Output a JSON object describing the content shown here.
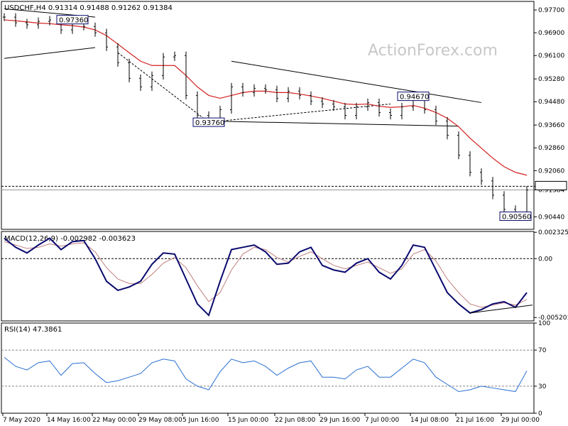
{
  "watermark": "ActionForex.com",
  "colors": {
    "price": "#000000",
    "ma": "#d22020",
    "macd": "#0a0a6e",
    "signal": "#c08080",
    "rsi": "#2a6fd0",
    "trend": "#000000",
    "tagBorder": "#0a0a6e"
  },
  "chart_data": [
    {
      "type": "line",
      "title": "USDCHF,H4  0.91314 0.91488 0.91262 0.91384",
      "ylim": [
        0.9,
        0.98
      ],
      "yticks": [
        "0.97700",
        "0.96900",
        "0.96100",
        "0.95280",
        "0.94480",
        "0.93660",
        "0.92860",
        "0.92060",
        "0.91510",
        "0.91384",
        "0.90440"
      ],
      "ytick_values": [
        0.977,
        0.969,
        0.961,
        0.9528,
        0.9448,
        0.9366,
        0.9286,
        0.9206,
        0.9151,
        0.91384,
        0.9044
      ],
      "x": [
        "7 May 2020",
        "14 May 16:00",
        "22 May 00:00",
        "29 May 08:00",
        "5 Jun 16:00",
        "15 Jun 00:00",
        "22 Jun 08:00",
        "29 Jun 16:00",
        "7 Jul 00:00",
        "14 Jul 08:00",
        "21 Jul 16:00",
        "29 Jul 00:00"
      ],
      "series": [
        {
          "values": [
            0.9745,
            0.9725,
            0.9718,
            0.973,
            0.9735,
            0.97,
            0.9736,
            0.9712,
            0.969,
            0.964,
            0.9585,
            0.953,
            0.95,
            0.954,
            0.9605,
            0.961,
            0.947,
            0.94,
            0.9376,
            0.942,
            0.95,
            0.948,
            0.9495,
            0.949,
            0.946,
            0.9485,
            0.947,
            0.945,
            0.944,
            0.943,
            0.94,
            0.943,
            0.9445,
            0.941,
            0.94,
            0.943,
            0.946,
            0.942,
            0.938,
            0.933,
            0.926,
            0.92,
            0.917,
            0.912,
            0.907,
            0.9056,
            0.9138
          ]
        },
        {
          "values": [
            0.9735,
            0.9732,
            0.9728,
            0.9724,
            0.9722,
            0.9718,
            0.9715,
            0.971,
            0.97,
            0.968,
            0.965,
            0.962,
            0.959,
            0.9575,
            0.9575,
            0.9575,
            0.954,
            0.95,
            0.947,
            0.946,
            0.947,
            0.948,
            0.9485,
            0.9485,
            0.948,
            0.948,
            0.9475,
            0.9468,
            0.946,
            0.945,
            0.944,
            0.9438,
            0.944,
            0.9432,
            0.9428,
            0.943,
            0.9435,
            0.9425,
            0.941,
            0.939,
            0.936,
            0.932,
            0.9285,
            0.925,
            0.922,
            0.92,
            0.919
          ]
        }
      ],
      "horizontal_line": 0.9151,
      "annotations": [
        {
          "text": "0.97360",
          "value": 0.9736,
          "at": 6
        },
        {
          "text": "0.93760",
          "value": 0.9376,
          "at": 18
        },
        {
          "text": "0.94670",
          "value": 0.9467,
          "at": 36
        },
        {
          "text": "0.90560",
          "value": 0.9056,
          "at": 45
        }
      ]
    },
    {
      "type": "line",
      "title": "MACD(12,26,9) -0.002982 -0.003623",
      "ylim": [
        -0.0055,
        0.0024
      ],
      "yticks": [
        "0.002325",
        "0.00",
        "-0.005201"
      ],
      "ytick_values": [
        0.002325,
        0.0,
        -0.005201
      ],
      "series": [
        {
          "values": [
            0.0018,
            0.001,
            0.0005,
            0.0012,
            0.0018,
            0.0008,
            0.0015,
            0.0016,
            0.0,
            -0.002,
            -0.0028,
            -0.0025,
            -0.002,
            -0.0005,
            0.0005,
            0.0004,
            -0.0018,
            -0.004,
            -0.005,
            -0.002,
            0.0008,
            0.001,
            0.0012,
            0.0006,
            -0.0005,
            -0.0004,
            0.0006,
            0.001,
            -0.0006,
            -0.001,
            -0.0012,
            -0.0004,
            0.0,
            -0.0012,
            -0.0018,
            -0.0006,
            0.0012,
            0.001,
            -0.001,
            -0.003,
            -0.004,
            -0.0048,
            -0.0045,
            -0.004,
            -0.0038,
            -0.0043,
            -0.003
          ]
        },
        {
          "values": [
            0.0015,
            0.0012,
            0.0009,
            0.001,
            0.0013,
            0.0011,
            0.0013,
            0.0014,
            0.0006,
            -0.0008,
            -0.0018,
            -0.0022,
            -0.0022,
            -0.0014,
            -0.0004,
            0.0001,
            -0.0008,
            -0.0024,
            -0.0038,
            -0.003,
            -0.001,
            0.0004,
            0.001,
            0.0008,
            0.0001,
            -0.0003,
            0.0002,
            0.0006,
            0.0,
            -0.0006,
            -0.0009,
            -0.0006,
            -0.0003,
            -0.0008,
            -0.0013,
            -0.0009,
            0.0004,
            0.0008,
            -0.0002,
            -0.0018,
            -0.003,
            -0.004,
            -0.0043,
            -0.0041,
            -0.0039,
            -0.0041,
            -0.0036
          ]
        }
      ]
    },
    {
      "type": "line",
      "title": "RSI(14) 47.3861",
      "ylim": [
        0,
        100
      ],
      "yticks": [
        "100",
        "70",
        "30",
        "0"
      ],
      "ytick_values": [
        100,
        70,
        30,
        0
      ],
      "series": [
        {
          "values": [
            62,
            52,
            48,
            56,
            58,
            42,
            55,
            56,
            44,
            34,
            36,
            40,
            44,
            56,
            60,
            58,
            38,
            30,
            26,
            46,
            60,
            56,
            58,
            52,
            42,
            50,
            56,
            58,
            40,
            40,
            38,
            48,
            52,
            40,
            40,
            50,
            60,
            56,
            40,
            32,
            24,
            26,
            30,
            28,
            26,
            24,
            47
          ]
        }
      ]
    }
  ],
  "x_axis_labels": [
    "7 May 2020",
    "14 May 16:00",
    "22 May 00:00",
    "29 May 08:00",
    "5 Jun 16:00",
    "15 Jun 00:00",
    "22 Jun 08:00",
    "29 Jun 16:00",
    "7 Jul 00:00",
    "14 Jul 08:00",
    "21 Jul 16:00",
    "29 Jul 00:00"
  ]
}
